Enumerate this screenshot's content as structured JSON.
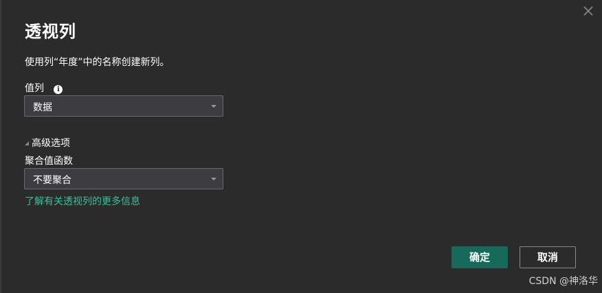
{
  "dialog": {
    "title": "透视列",
    "description": "使用列“年度”中的名称创建新列。",
    "close_icon": "close-icon"
  },
  "values_column": {
    "label": "值列",
    "info_icon": "i",
    "selected": "数据"
  },
  "advanced": {
    "toggle_label": "高级选项"
  },
  "aggregate": {
    "label": "聚合值函数",
    "selected": "不要聚合"
  },
  "learn_more": "了解有关透视列的更多信息",
  "buttons": {
    "ok": "确定",
    "cancel": "取消"
  },
  "watermark": "CSDN @神洛华",
  "colors": {
    "background": "#2b2b2b",
    "primary_button": "#17695a",
    "link": "#3cbf9a",
    "select_bg": "#3c3c41"
  }
}
